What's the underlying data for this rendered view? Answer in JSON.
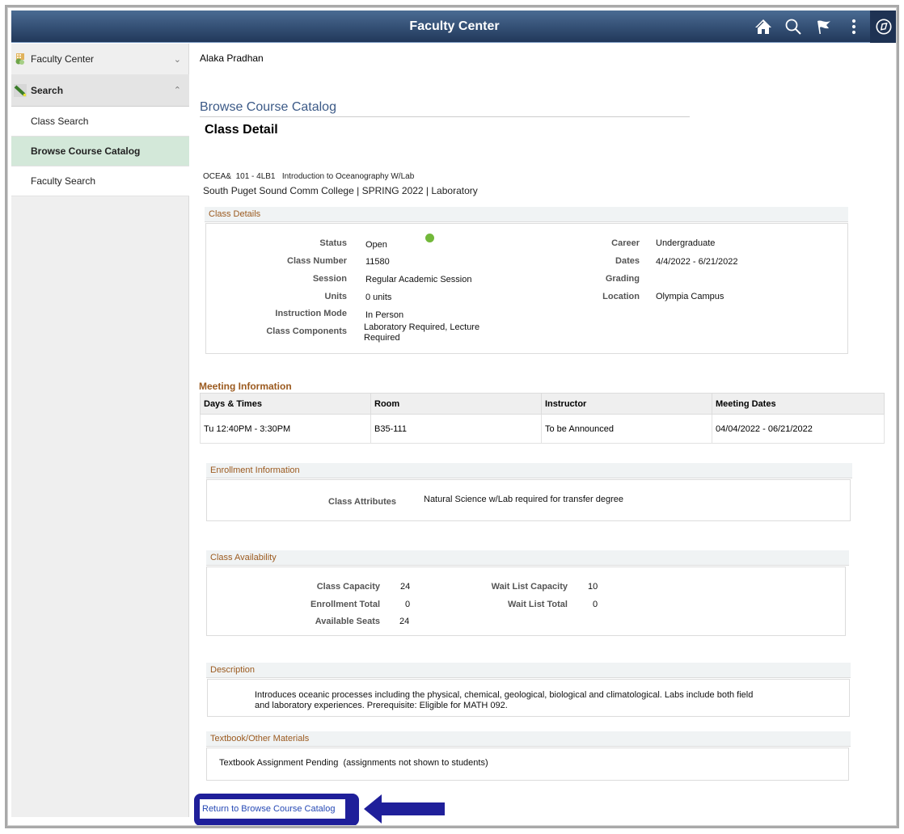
{
  "header": {
    "title": "Faculty Center",
    "icons": [
      "home-icon",
      "search-icon",
      "flag-icon",
      "more-options-icon",
      "navbar-compass-icon"
    ]
  },
  "sidebar": {
    "groups": [
      {
        "label": "Faculty Center",
        "icon": "faculty-center-icon",
        "chevron": "chevron-down-icon"
      },
      {
        "label": "Search",
        "icon": "search-magic-wand-icon",
        "chevron": "chevron-up-icon"
      }
    ],
    "items": [
      {
        "label": "Class Search",
        "active": false
      },
      {
        "label": "Browse Course Catalog",
        "active": true
      },
      {
        "label": "Faculty Search",
        "active": false
      }
    ]
  },
  "main": {
    "user_name": "Alaka Pradhan",
    "page_heading": "Browse Course Catalog",
    "page_title": "Class Detail",
    "course_line": "OCEA&  101 - 4LB1   Introduction to Oceanography W/Lab",
    "course_sub": "South Puget Sound Comm College | SPRING 2022 | Laboratory",
    "class_details": {
      "title": "Class Details",
      "status_color": "#72b83a",
      "left": [
        {
          "label": "Status",
          "value": "Open"
        },
        {
          "label": "Class Number",
          "value": "11580"
        },
        {
          "label": "Session",
          "value": "Regular Academic Session"
        },
        {
          "label": "Units",
          "value": "0 units"
        },
        {
          "label": "Instruction Mode",
          "value": "In Person"
        },
        {
          "label": "Class Components",
          "value": "Laboratory Required, Lecture Required"
        }
      ],
      "right": [
        {
          "label": "Career",
          "value": "Undergraduate"
        },
        {
          "label": "Dates",
          "value": "4/4/2022 - 6/21/2022"
        },
        {
          "label": "Grading",
          "value": ""
        },
        {
          "label": "Location",
          "value": "Olympia Campus"
        }
      ]
    },
    "meeting": {
      "title": "Meeting Information",
      "columns": [
        "Days & Times",
        "Room",
        "Instructor",
        "Meeting Dates"
      ],
      "rows": [
        [
          "Tu 12:40PM - 3:30PM",
          "B35-111",
          "To be Announced",
          "04/04/2022 - 06/21/2022"
        ]
      ]
    },
    "enrollment": {
      "title": "Enrollment Information",
      "label": "Class Attributes",
      "value": "Natural Science w/Lab required for transfer degree"
    },
    "availability": {
      "title": "Class Availability",
      "class_capacity_label": "Class Capacity",
      "class_capacity": "24",
      "enrollment_total_label": "Enrollment Total",
      "enrollment_total": "0",
      "available_seats_label": "Available Seats",
      "available_seats": "24",
      "wait_list_capacity_label": "Wait List Capacity",
      "wait_list_capacity": "10",
      "wait_list_total_label": "Wait List Total",
      "wait_list_total": "0"
    },
    "description": {
      "title": "Description",
      "text_line1": "Introduces oceanic processes including the physical, chemical, geological, biological and climatological. Labs include both field",
      "text_line2": "and laboratory experiences. Prerequisite: Eligible for MATH 092."
    },
    "textbook": {
      "title": "Textbook/Other Materials",
      "text": "Textbook Assignment Pending  (assignments not shown to students)"
    },
    "return_link": "Return to Browse Course Catalog",
    "annotation_color": "#1f1f9a"
  }
}
